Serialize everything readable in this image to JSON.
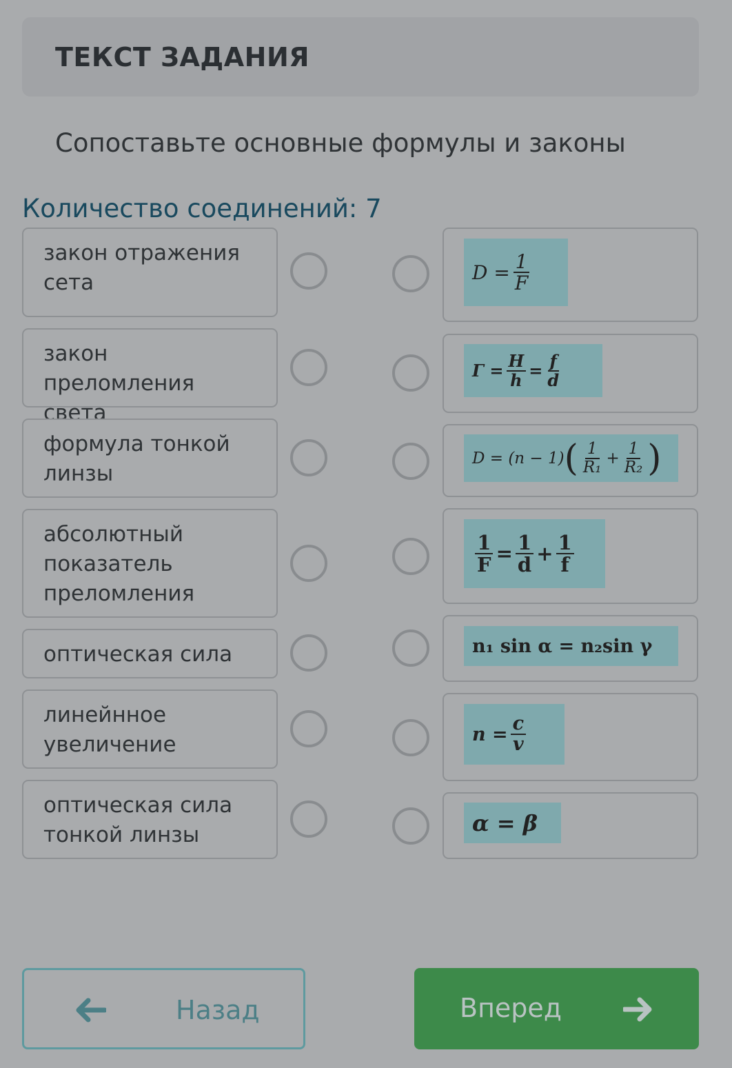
{
  "header": {
    "title": "ТЕКСТ ЗАДАНИЯ"
  },
  "task": {
    "instruction": "Сопоставьте основные формулы и законы",
    "connections": "Количество соединений: 7"
  },
  "left_items": [
    "закон отражения\nсета",
    "закон преломления\nсвета",
    "формула тонкой\nлинзы",
    "абсолютный\nпоказатель\nпреломления",
    "оптическая сила",
    "линейнное\nувеличение",
    "оптическая сила\nтонкой линзы"
  ],
  "right_formulas": {
    "f1": {
      "lhs": "D =",
      "num": "1",
      "den": "F"
    },
    "f2": {
      "lhs": "Γ =",
      "num1": "H",
      "den1": "h",
      "eq": "=",
      "num2": "f",
      "den2": "d"
    },
    "f3": {
      "lhs": "D = (n − 1)",
      "num1": "1",
      "den1": "R₁",
      "plus": "+",
      "num2": "1",
      "den2": "R₂"
    },
    "f4": {
      "num0": "1",
      "den0": "F",
      "eq": "=",
      "num1": "1",
      "den1": "d",
      "plus": "+",
      "num2": "1",
      "den2": "f"
    },
    "f5": {
      "text": "n₁ sin α = n₂sin γ"
    },
    "f6": {
      "lhs": "n =",
      "num": "c",
      "den": "v"
    },
    "f7": {
      "text": "α = β"
    }
  },
  "nav": {
    "back_label": "Назад",
    "next_label": "Вперед"
  },
  "colors": {
    "accent_teal": "#5e9a9f",
    "next_green": "#3d8a4a",
    "count_blue": "#19495e"
  }
}
